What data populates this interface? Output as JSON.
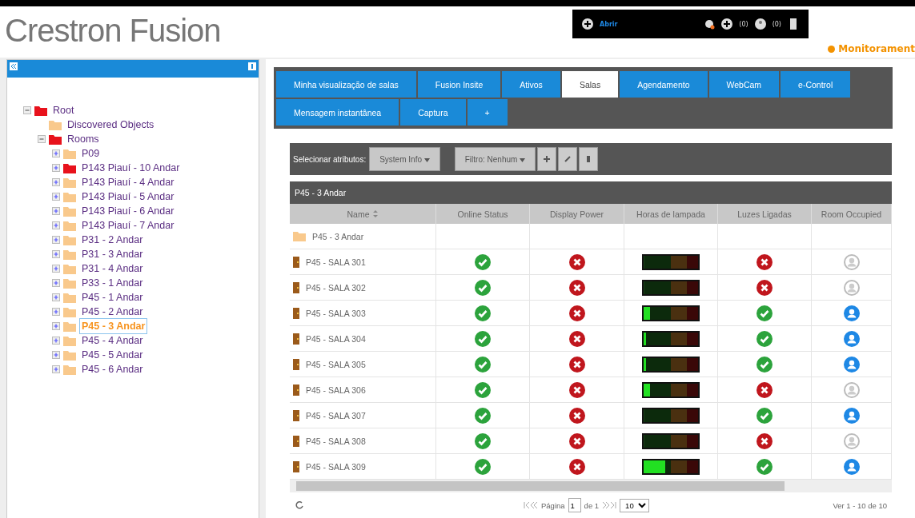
{
  "header": {
    "logo": "Crestron Fusion",
    "toolbar": {
      "open_link": "Abrir",
      "alerts_count": "(0)",
      "users_count": "(0)"
    },
    "mode": "Monitorament"
  },
  "tree": [
    {
      "label": "Root",
      "kind": "node",
      "color": "#e8121c",
      "expanded": true,
      "selected": false,
      "children": [
        {
          "label": "Discovered Objects",
          "kind": "leaf",
          "color": "#f9c98c",
          "selected": false
        },
        {
          "label": "Rooms",
          "kind": "node",
          "color": "#e8121c",
          "expanded": true,
          "selected": false,
          "children": [
            {
              "label": "P09",
              "kind": "node",
              "color": "#f9c98c",
              "expanded": false,
              "selected": false
            },
            {
              "label": "P143 Piauí - 10 Andar",
              "kind": "node",
              "color": "#e8121c",
              "expanded": false,
              "selected": false
            },
            {
              "label": "P143 Piauí - 4 Andar",
              "kind": "node",
              "color": "#f9c98c",
              "expanded": false,
              "selected": false
            },
            {
              "label": "P143 Piauí - 5 Andar",
              "kind": "node",
              "color": "#f9c98c",
              "expanded": false,
              "selected": false
            },
            {
              "label": "P143 Piauí - 6 Andar",
              "kind": "node",
              "color": "#f9c98c",
              "expanded": false,
              "selected": false
            },
            {
              "label": "P143 Piauí - 7 Andar",
              "kind": "node",
              "color": "#f9c98c",
              "expanded": false,
              "selected": false
            },
            {
              "label": "P31 - 2 Andar",
              "kind": "node",
              "color": "#f9c98c",
              "expanded": false,
              "selected": false
            },
            {
              "label": "P31 - 3 Andar",
              "kind": "node",
              "color": "#f9c98c",
              "expanded": false,
              "selected": false
            },
            {
              "label": "P31 - 4 Andar",
              "kind": "node",
              "color": "#f9c98c",
              "expanded": false,
              "selected": false
            },
            {
              "label": "P33 - 1 Andar",
              "kind": "node",
              "color": "#f9c98c",
              "expanded": false,
              "selected": false
            },
            {
              "label": "P45 - 1 Andar",
              "kind": "node",
              "color": "#f9c98c",
              "expanded": false,
              "selected": false
            },
            {
              "label": "P45 - 2 Andar",
              "kind": "node",
              "color": "#f9c98c",
              "expanded": false,
              "selected": false
            },
            {
              "label": "P45 - 3 Andar",
              "kind": "node",
              "color": "#f9c98c",
              "expanded": false,
              "selected": true
            },
            {
              "label": "P45 - 4 Andar",
              "kind": "node",
              "color": "#f9c98c",
              "expanded": false,
              "selected": false
            },
            {
              "label": "P45 - 5 Andar",
              "kind": "node",
              "color": "#f9c98c",
              "expanded": false,
              "selected": false
            },
            {
              "label": "P45 - 6 Andar",
              "kind": "node",
              "color": "#f9c98c",
              "expanded": false,
              "selected": false
            }
          ]
        }
      ]
    }
  ],
  "tabs": [
    [
      {
        "label": "Minha visualização de salas",
        "selected": false
      },
      {
        "label": "Fusion Insite",
        "selected": false
      },
      {
        "label": "Ativos",
        "selected": false
      },
      {
        "label": "Salas",
        "selected": true
      },
      {
        "label": "Agendamento",
        "selected": false
      },
      {
        "label": "WebCam",
        "selected": false
      },
      {
        "label": "e-Control",
        "selected": false
      }
    ],
    [
      {
        "label": "Mensagem instantânea",
        "selected": false
      },
      {
        "label": "Captura",
        "selected": false
      },
      {
        "label": "+",
        "selected": false
      }
    ]
  ],
  "filter_bar": {
    "label": "Selecionar atributos:",
    "attributes": "System Info",
    "filter": "Filtro: Nenhum"
  },
  "table": {
    "title": "P45 - 3 Andar",
    "columns": [
      "Name",
      "Online Status",
      "Display Power",
      "Horas de lampada",
      "Luzes Ligadas",
      "Room Occupied"
    ],
    "rows": [
      {
        "kind": "folder",
        "name": "P45 - 3 Andar"
      },
      {
        "kind": "room",
        "name": "P45 - SALA 301",
        "online": true,
        "display_power": false,
        "level": 0,
        "lights": false,
        "occupied": false
      },
      {
        "kind": "room",
        "name": "P45 - SALA 302",
        "online": true,
        "display_power": false,
        "level": 0,
        "lights": false,
        "occupied": false
      },
      {
        "kind": "room",
        "name": "P45 - SALA 303",
        "online": true,
        "display_power": false,
        "level": 0.12,
        "lights": true,
        "occupied": true
      },
      {
        "kind": "room",
        "name": "P45 - SALA 304",
        "online": true,
        "display_power": false,
        "level": 0.04,
        "lights": true,
        "occupied": true
      },
      {
        "kind": "room",
        "name": "P45 - SALA 305",
        "online": true,
        "display_power": false,
        "level": 0.04,
        "lights": true,
        "occupied": true
      },
      {
        "kind": "room",
        "name": "P45 - SALA 306",
        "online": true,
        "display_power": false,
        "level": 0.12,
        "lights": false,
        "occupied": false
      },
      {
        "kind": "room",
        "name": "P45 - SALA 307",
        "online": true,
        "display_power": false,
        "level": 0,
        "lights": true,
        "occupied": true
      },
      {
        "kind": "room",
        "name": "P45 - SALA 308",
        "online": true,
        "display_power": false,
        "level": 0,
        "lights": false,
        "occupied": false
      },
      {
        "kind": "room",
        "name": "P45 - SALA 309",
        "online": true,
        "display_power": false,
        "level": 0.4,
        "lights": true,
        "occupied": true
      }
    ]
  },
  "pager": {
    "page_label": "Página",
    "page": "1",
    "of": "de 1",
    "page_size": "10",
    "summary": "Ver 1 - 10 de 10"
  }
}
